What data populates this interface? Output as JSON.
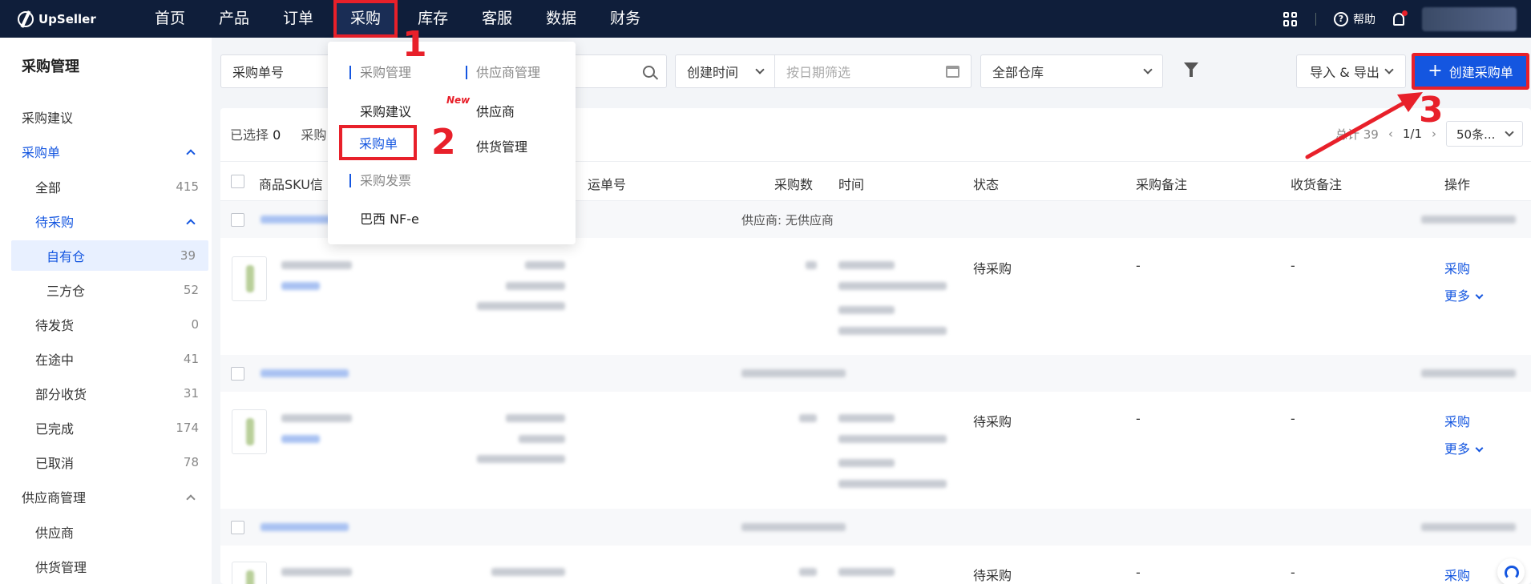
{
  "app": {
    "logo": "UpSeller"
  },
  "nav": {
    "items": [
      "首页",
      "产品",
      "订单",
      "采购",
      "库存",
      "客服",
      "数据",
      "财务"
    ],
    "active_index": 3,
    "help_label": "帮助"
  },
  "sidebar": {
    "title": "采购管理",
    "items": [
      {
        "label": "采购建议"
      },
      {
        "label": "采购单"
      },
      {
        "label": "全部",
        "count": "415"
      },
      {
        "label": "待采购"
      },
      {
        "label": "自有仓",
        "count": "39"
      },
      {
        "label": "三方仓",
        "count": "52"
      },
      {
        "label": "待发货",
        "count": "0"
      },
      {
        "label": "在途中",
        "count": "41"
      },
      {
        "label": "部分收货",
        "count": "31"
      },
      {
        "label": "已完成",
        "count": "174"
      },
      {
        "label": "已取消",
        "count": "78"
      },
      {
        "label": "供应商管理"
      },
      {
        "label": "供应商"
      },
      {
        "label": "供货管理"
      }
    ]
  },
  "filters": {
    "search_type": "采购单号",
    "time_type": "创建时间",
    "date_placeholder": "按日期筛选",
    "warehouse": "全部仓库"
  },
  "toolbar": {
    "import_export": "导入 & 导出",
    "create": "创建采购单"
  },
  "table": {
    "selected_label": "已选择",
    "selected_count": "0",
    "purchase_label": "采购",
    "total_label": "总计 39",
    "page": "1/1",
    "page_size": "50条...",
    "headers": {
      "sku": "商品SKU信",
      "waybill": "运单号",
      "qty": "采购数",
      "time": "时间",
      "status": "状态",
      "purchase_note": "采购备注",
      "receive_note": "收货备注",
      "action": "操作"
    },
    "group1_supplier": "供应商: 无供应商",
    "rows": [
      {
        "status": "待采购",
        "purchase_note": "-",
        "receive_note": "-",
        "action": "采购",
        "more": "更多"
      },
      {
        "status": "待采购",
        "purchase_note": "-",
        "receive_note": "-",
        "action": "采购",
        "more": "更多"
      },
      {
        "status": "待采购",
        "purchase_note": "-",
        "receive_note": "-",
        "action": "采购"
      }
    ]
  },
  "dropdown": {
    "col1_head": "采购管理",
    "col1_items": [
      "采购建议",
      "采购单"
    ],
    "new_tag": "New",
    "col1_head2": "采购发票",
    "col1_items2": [
      "巴西 NF-e"
    ],
    "col2_head": "供应商管理",
    "col2_items": [
      "供应商",
      "供货管理"
    ]
  },
  "annotations": [
    "1",
    "2",
    "3"
  ],
  "colors": {
    "accent": "#1456e0",
    "topbar": "#0f1e3a",
    "highlight": "#e8202a"
  }
}
